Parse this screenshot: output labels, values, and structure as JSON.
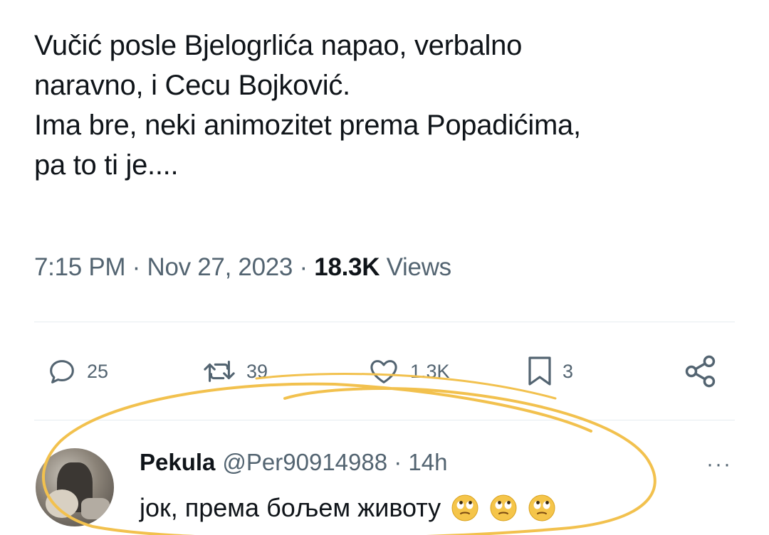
{
  "tweet": {
    "lines": [
      "Vučić posle Bjelogrlića napao, verbalno",
      "naravno, i Cecu Bojković.",
      "Ima bre, neki animozitet prema Popadićima,",
      "pa to ti je...."
    ],
    "time": "7:15 PM",
    "sep1": " · ",
    "date": "Nov 27, 2023",
    "sep2": " · ",
    "views_count": "18.3K",
    "views_label": "Views"
  },
  "actions": {
    "replies": "25",
    "retweets": "39",
    "likes": "1.3K",
    "bookmarks": "3",
    "icons": [
      "reply-icon",
      "retweet-icon",
      "like-icon",
      "bookmark-icon",
      "share-icon"
    ]
  },
  "reply": {
    "name": "Pekula",
    "handle": "@Per90914988",
    "sep": " · ",
    "time": "14h",
    "text": "јок, према бољем животу",
    "more": "···",
    "emoji": [
      "rolling-eyes-emoji",
      "rolling-eyes-emoji",
      "rolling-eyes-emoji"
    ]
  },
  "colors": {
    "text": "#0f1419",
    "secondary": "#536471",
    "divider": "#e6ecf0",
    "highlight_ring": "#f2c14e",
    "emoji_face": "#f5c54a"
  }
}
